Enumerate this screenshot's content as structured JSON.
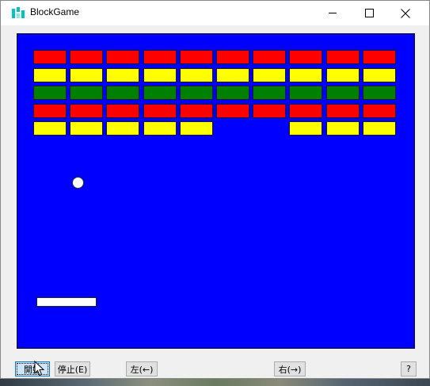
{
  "window": {
    "title": "BlockGame",
    "app_icon": "block-game-icon",
    "caption_buttons": [
      "minimize-icon",
      "maximize-icon",
      "close-icon"
    ]
  },
  "game": {
    "background_color": "#0000ff",
    "brick_colors": {
      "red": "#ff0000",
      "yellow": "#ffff00",
      "green": "#008000"
    },
    "rows": [
      [
        "red",
        "red",
        "red",
        "red",
        "red",
        "red",
        "red",
        "red",
        "red",
        "red"
      ],
      [
        "yellow",
        "yellow",
        "yellow",
        "yellow",
        "yellow",
        "yellow",
        "yellow",
        "yellow",
        "yellow",
        "yellow"
      ],
      [
        "green",
        "green",
        "green",
        "green",
        "green",
        "green",
        "green",
        "green",
        "green",
        "green"
      ],
      [
        "red",
        "red",
        "red",
        "red",
        "red",
        "red",
        "red",
        "red",
        "red",
        "red"
      ],
      [
        "yellow",
        "yellow",
        "yellow",
        "yellow",
        "yellow",
        null,
        null,
        "yellow",
        "yellow",
        "yellow"
      ]
    ],
    "ball_color": "#ffffff",
    "paddle_color": "#ffffff"
  },
  "controls": {
    "start_label": "開始",
    "stop_label": "停止(E)",
    "left_label": "左(←)",
    "right_label": "右(→)",
    "help_label": "?"
  }
}
